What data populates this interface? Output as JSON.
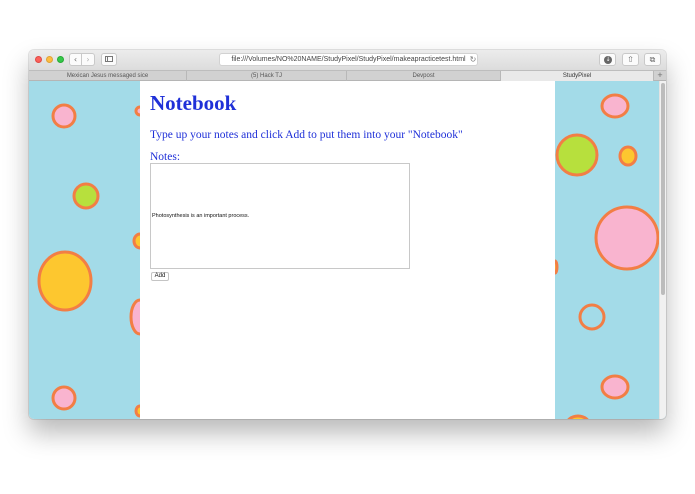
{
  "browser": {
    "url": "file:///Volumes/NO%20NAME/StudyPixel/StudyPixel/makeapracticetest.html",
    "back_glyph": "‹",
    "forward_glyph": "›",
    "reload_glyph": "↻",
    "download_glyph": "↓",
    "share_glyph": "⇧",
    "tabs_glyph": "⧉",
    "new_tab_glyph": "+",
    "tabs": [
      {
        "label": "Mexican Jesus messaged sice"
      },
      {
        "label": "(5) Hack TJ"
      },
      {
        "label": "Devpost"
      },
      {
        "label": "StudyPixel"
      }
    ]
  },
  "page": {
    "heading": "Notebook",
    "instructions": "Type up your notes and click Add to put them into your \"Notebook\"",
    "notes_label": "Notes:",
    "notes_value": "Photosynthesis is an important process.",
    "add_button": "Add"
  },
  "colors": {
    "background": "#a3dbe8",
    "heading": "#1f30d8",
    "bubble_pink": "#f9b4cf",
    "bubble_green": "#b7e03d",
    "bubble_yellow": "#fdc72f",
    "bubble_outline": "#f27e45"
  },
  "icons": {
    "window_controls": [
      "close-icon",
      "minimize-icon",
      "maximize-icon"
    ],
    "sidebar": "sidebar-icon",
    "reload": "reload-icon",
    "download": "download-icon",
    "share": "share-icon",
    "tabs": "tab-overview-icon"
  }
}
